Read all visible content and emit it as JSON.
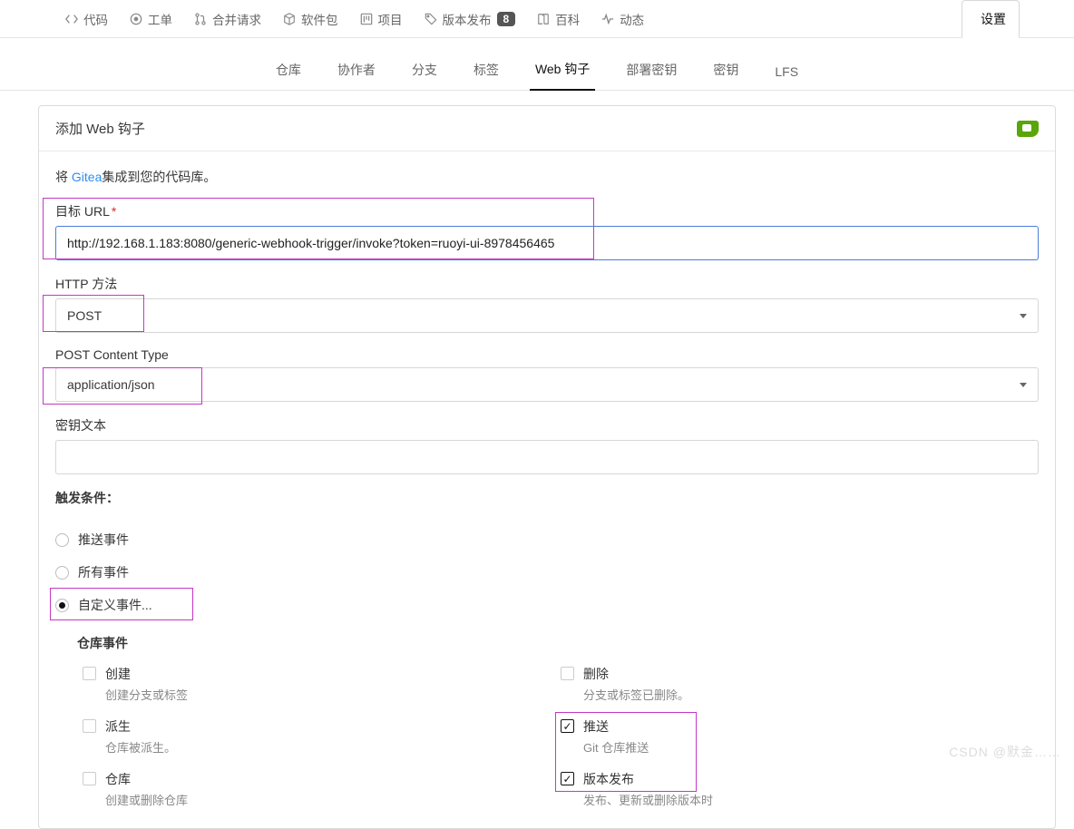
{
  "repoTabs": {
    "code": "代码",
    "issues": "工单",
    "pulls": "合并请求",
    "packages": "软件包",
    "projects": "项目",
    "releases": "版本发布",
    "releasesCount": "8",
    "wiki": "百科",
    "activity": "动态",
    "settings": "设置"
  },
  "subTabs": {
    "repo": "仓库",
    "collab": "协作者",
    "branches": "分支",
    "tags": "标签",
    "webhooks": "Web 钩子",
    "deployKeys": "部署密钥",
    "secrets": "密钥",
    "lfs": "LFS"
  },
  "panel": {
    "title": "添加 Web 钩子",
    "intro_pre": "将 ",
    "intro_link": "Gitea",
    "intro_post": "集成到您的代码库。"
  },
  "form": {
    "url_label": "目标 URL",
    "url_value": "http://192.168.1.183:8080/generic-webhook-trigger/invoke?token=ruoyi-ui-8978456465",
    "method_label": "HTTP 方法",
    "method_value": "POST",
    "ct_label": "POST Content Type",
    "ct_value": "application/json",
    "secret_label": "密钥文本",
    "secret_value": "",
    "trigger_label": "触发条件：",
    "radio_push": "推送事件",
    "radio_all": "所有事件",
    "radio_custom": "自定义事件..."
  },
  "events": {
    "section": "仓库事件",
    "create_t": "创建",
    "create_d": "创建分支或标签",
    "delete_t": "删除",
    "delete_d": "分支或标签已删除。",
    "fork_t": "派生",
    "fork_d": "仓库被派生。",
    "push_t": "推送",
    "push_d": "Git 仓库推送",
    "repo_t": "仓库",
    "repo_d": "创建或删除仓库",
    "rel_t": "版本发布",
    "rel_d": "发布、更新或删除版本时"
  },
  "watermark": "CSDN @默金……"
}
